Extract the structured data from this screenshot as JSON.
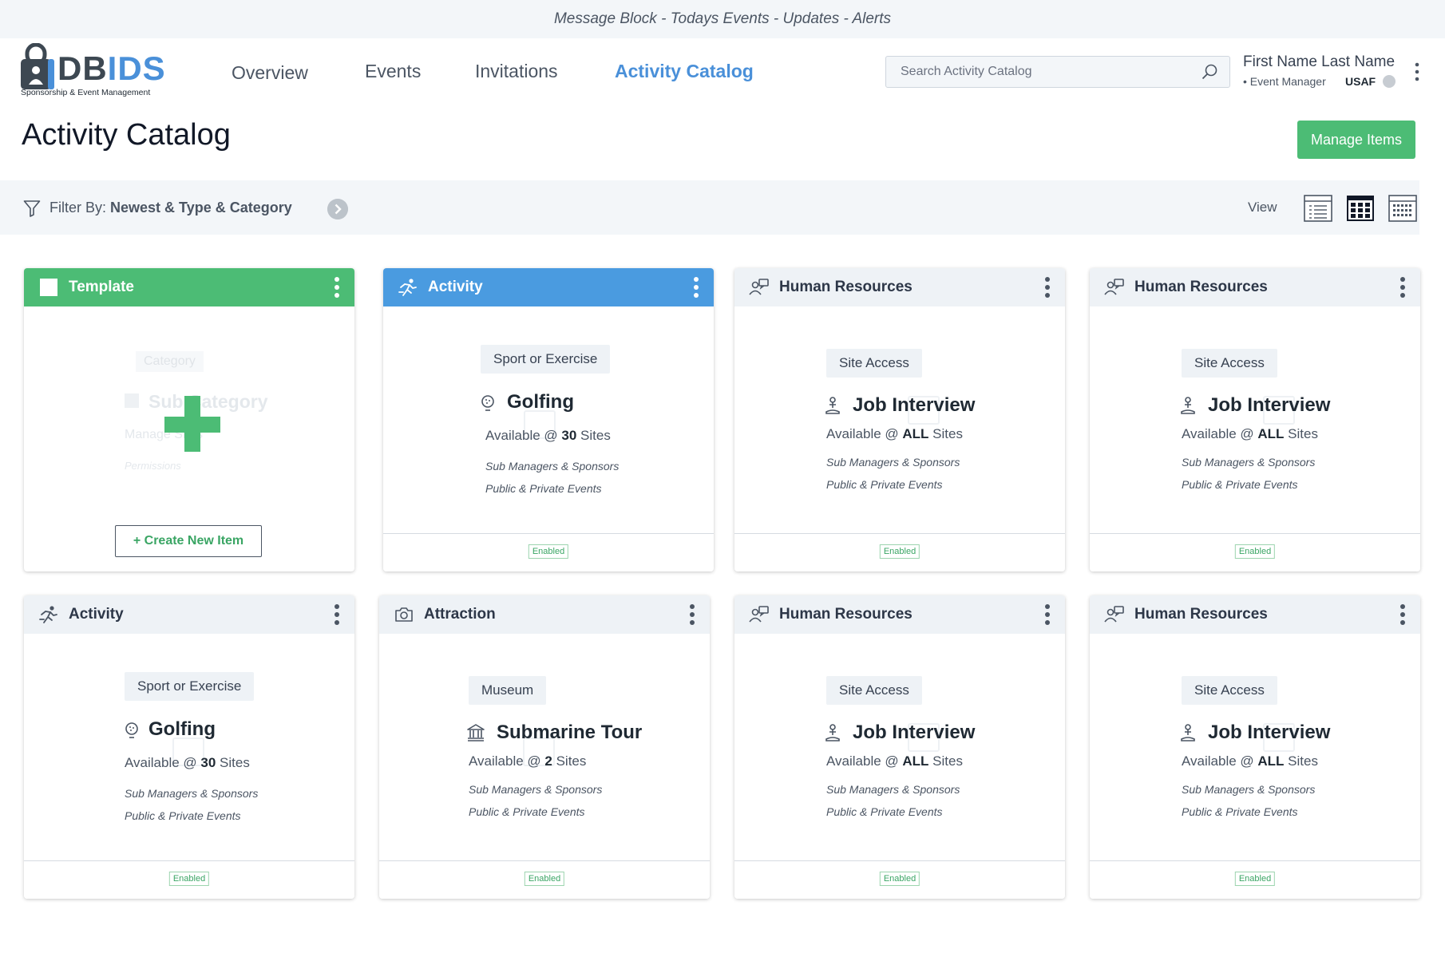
{
  "message_bar": "Message Block - Todays Events - Updates - Alerts",
  "brand": {
    "name_part1": "DB",
    "name_part2": "IDS",
    "tagline": "Sponsorship & Event Management",
    "accent": "#4a90d9"
  },
  "nav": [
    {
      "label": "Overview",
      "active": false
    },
    {
      "label": "Events",
      "active": false
    },
    {
      "label": "Invitations",
      "active": false
    },
    {
      "label": "Activity Catalog",
      "active": true
    }
  ],
  "search": {
    "placeholder": "Search Activity Catalog",
    "icon": "search-icon"
  },
  "user": {
    "name": "First Name Last Name",
    "role": "• Event Manager",
    "org": "USAF"
  },
  "page": {
    "title": "Activity Catalog",
    "manage_button": "Manage Items"
  },
  "filter": {
    "label": "Filter By: ",
    "value": "Newest & Type & Category"
  },
  "view": {
    "label": "View",
    "options": [
      "list-view-icon",
      "grid-view-icon",
      "calendar-view-icon"
    ],
    "selected": "grid-view-icon"
  },
  "template_card": {
    "header": "Template",
    "ghost_category": "Category",
    "ghost_subcategory": "Sub Category",
    "ghost_manage": "Manage Sites",
    "ghost_permissions": "Permissions",
    "create_button": "+ Create New Item"
  },
  "cards": [
    {
      "header": "Activity",
      "header_icon": "runner-icon",
      "chip": "Sport or Exercise",
      "name": "Golfing",
      "name_icon": "golf-ball-icon",
      "avail_prefix": "Available @ ",
      "avail_count": "30",
      "avail_suffix": " Sites",
      "meta1": "Sub Managers & Sponsors",
      "meta2": "Public & Private Events",
      "status": "Enabled"
    },
    {
      "header": "Human Resources",
      "header_icon": "hr-icon",
      "chip": "Site Access",
      "name": "Job Interview",
      "name_icon": "person-pin-icon",
      "avail_prefix": "Available @ ",
      "avail_count": "ALL",
      "avail_suffix": "  Sites",
      "meta1": "Sub Managers & Sponsors",
      "meta2": "Public & Private Events",
      "status": "Enabled"
    },
    {
      "header": "Human Resources",
      "header_icon": "hr-icon",
      "chip": "Site Access",
      "name": "Job Interview",
      "name_icon": "person-pin-icon",
      "avail_prefix": "Available @ ",
      "avail_count": "ALL",
      "avail_suffix": "  Sites",
      "meta1": "Sub Managers & Sponsors",
      "meta2": "Public & Private Events",
      "status": "Enabled"
    },
    {
      "header": "Activity",
      "header_icon": "runner-icon",
      "chip": "Sport or Exercise",
      "name": "Golfing",
      "name_icon": "golf-ball-icon",
      "avail_prefix": "Available @ ",
      "avail_count": "30",
      "avail_suffix": " Sites",
      "meta1": "Sub Managers & Sponsors",
      "meta2": "Public & Private Events",
      "status": "Enabled"
    },
    {
      "header": "Attraction",
      "header_icon": "camera-icon",
      "chip": "Museum",
      "name": "Submarine Tour",
      "name_icon": "museum-icon",
      "avail_prefix": "Available @ ",
      "avail_count": "2",
      "avail_suffix": " Sites",
      "meta1": "Sub Managers & Sponsors",
      "meta2": "Public & Private Events",
      "status": "Enabled"
    },
    {
      "header": "Human Resources",
      "header_icon": "hr-icon",
      "chip": "Site Access",
      "name": "Job Interview",
      "name_icon": "person-pin-icon",
      "avail_prefix": "Available @ ",
      "avail_count": "ALL",
      "avail_suffix": "  Sites",
      "meta1": "Sub Managers & Sponsors",
      "meta2": "Public & Private Events",
      "status": "Enabled"
    },
    {
      "header": "Human Resources",
      "header_icon": "hr-icon",
      "chip": "Site Access",
      "name": "Job Interview",
      "name_icon": "person-pin-icon",
      "avail_prefix": "Available @ ",
      "avail_count": "ALL",
      "avail_suffix": "  Sites",
      "meta1": "Sub Managers & Sponsors",
      "meta2": "Public & Private Events",
      "status": "Enabled"
    }
  ]
}
